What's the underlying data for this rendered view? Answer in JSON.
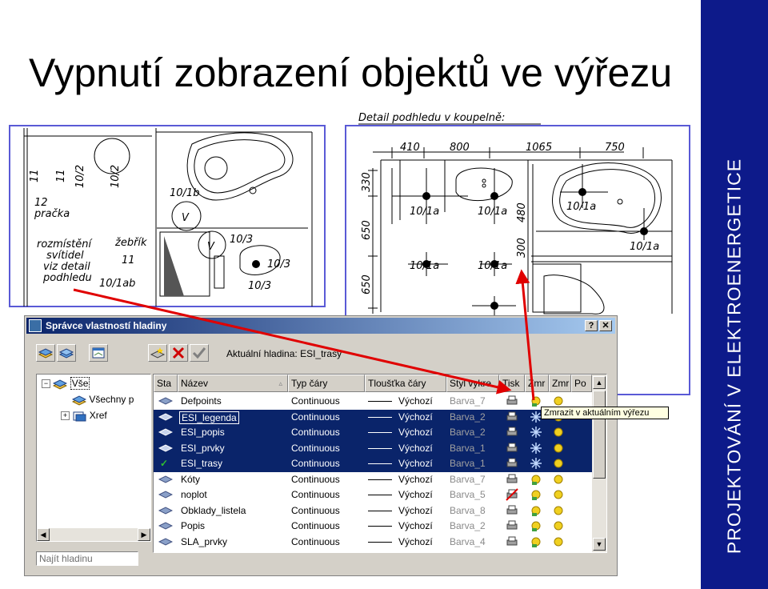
{
  "slide": {
    "title": "Vypnutí zobrazení objektů ve výřezu",
    "side_label": "PROJEKTOVÁNÍ V ELEKTROENERGETICE",
    "colors": {
      "side_bar": "#0d1a8a",
      "arrow": "#e00000",
      "selection": "#0a246a"
    }
  },
  "drawing": {
    "detail_caption": "Detail podhledu v koupelně:",
    "left_labels": [
      "11",
      "11",
      "10/2",
      "10/2",
      "12",
      "pračka",
      "10/1b",
      "rozmístění",
      "svítidel",
      "viz detail",
      "podhledu",
      "žebřík",
      "11",
      "10/3",
      "10/3",
      "10/3",
      "10/1ab",
      "V",
      "V"
    ],
    "top_dims": [
      "410",
      "800",
      "1065",
      "750"
    ],
    "side_dims": [
      "330",
      "650",
      "650",
      "480",
      "300"
    ],
    "fixture_labels": [
      "10/1a",
      "10/1a",
      "10/1a",
      "10/1a",
      "10/1a",
      "10/1a",
      "10/1a"
    ]
  },
  "dialog": {
    "title": "Správce vlastností hladiny",
    "help_btn": "?",
    "close_btn": "✕",
    "current_layer": "Aktuální hladina: ESI_trasy",
    "tree": [
      {
        "label": "Vše",
        "icon": "layers-icon"
      },
      {
        "label": "Všechny p",
        "icon": "layers-icon"
      },
      {
        "label": "Xref",
        "icon": "xref-icon"
      }
    ],
    "search_placeholder": "Najít hladinu",
    "columns": [
      "Sta",
      "Název",
      "Typ čáry",
      "Tloušťka čáry",
      "Styl vykre",
      "Tisk",
      "Zmr",
      "Zmr",
      "Po"
    ],
    "rows": [
      {
        "name": "Defpoints",
        "linetype": "Continuous",
        "lineweight": "Výchozí",
        "plotstyle": "Barva_7",
        "selected": false,
        "current": false
      },
      {
        "name": "ESI_legenda",
        "linetype": "Continuous",
        "lineweight": "Výchozí",
        "plotstyle": "Barva_2",
        "selected": true,
        "current": false
      },
      {
        "name": "ESI_popis",
        "linetype": "Continuous",
        "lineweight": "Výchozí",
        "plotstyle": "Barva_2",
        "selected": true,
        "current": false
      },
      {
        "name": "ESI_prvky",
        "linetype": "Continuous",
        "lineweight": "Výchozí",
        "plotstyle": "Barva_1",
        "selected": true,
        "current": false
      },
      {
        "name": "ESI_trasy",
        "linetype": "Continuous",
        "lineweight": "Výchozí",
        "plotstyle": "Barva_1",
        "selected": true,
        "current": true
      },
      {
        "name": "Kóty",
        "linetype": "Continuous",
        "lineweight": "Výchozí",
        "plotstyle": "Barva_7",
        "selected": false,
        "current": false
      },
      {
        "name": "noplot",
        "linetype": "Continuous",
        "lineweight": "Výchozí",
        "plotstyle": "Barva_5",
        "selected": false,
        "current": false
      },
      {
        "name": "Obklady_listela",
        "linetype": "Continuous",
        "lineweight": "Výchozí",
        "plotstyle": "Barva_8",
        "selected": false,
        "current": false
      },
      {
        "name": "Popis",
        "linetype": "Continuous",
        "lineweight": "Výchozí",
        "plotstyle": "Barva_2",
        "selected": false,
        "current": false
      },
      {
        "name": "SLA_prvky",
        "linetype": "Continuous",
        "lineweight": "Výchozí",
        "plotstyle": "Barva_4",
        "selected": false,
        "current": false
      }
    ],
    "tooltip": "Zmrazit v aktuálním výřezu"
  }
}
